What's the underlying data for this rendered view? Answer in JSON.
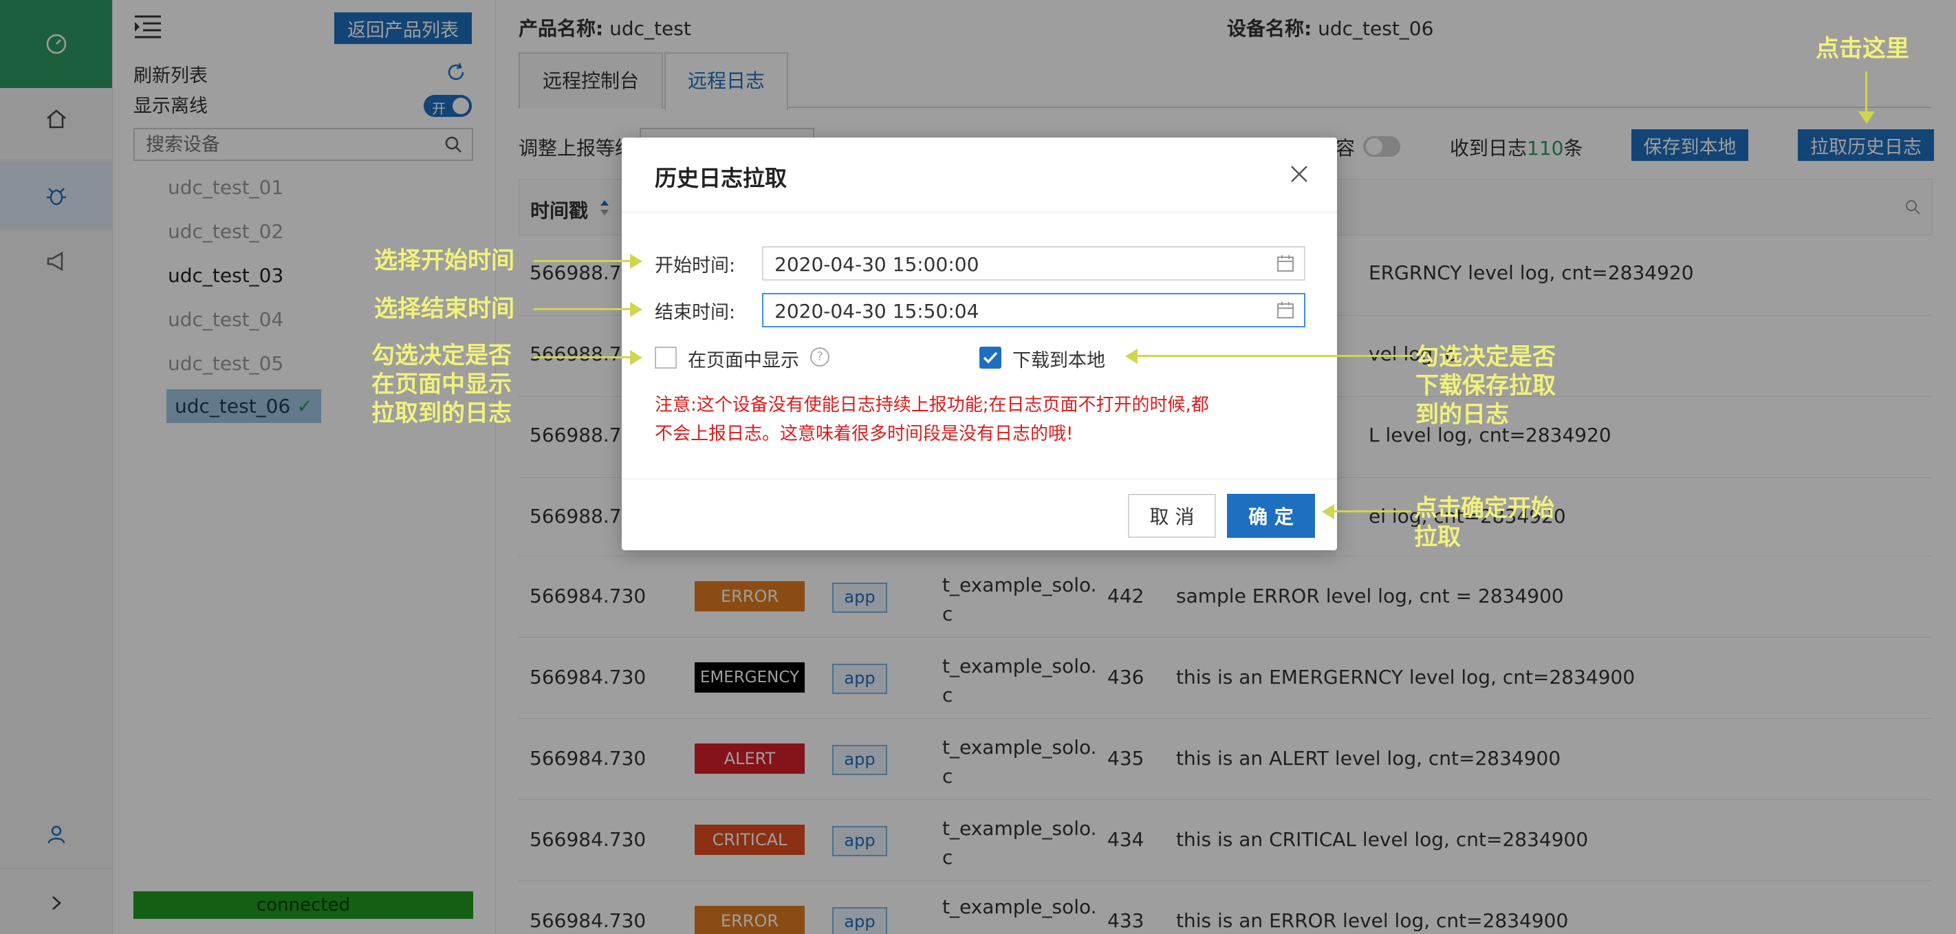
{
  "rail": {
    "icons": [
      "dashboard-icon",
      "home-icon",
      "bug-icon",
      "megaphone-icon",
      "user-icon",
      "chevron-right-icon"
    ]
  },
  "devpanel": {
    "back_button": "返回产品列表",
    "refresh_label": "刷新列表",
    "offline_label": "显示离线",
    "toggle_on": "开",
    "search_placeholder": "搜索设备",
    "devices": [
      {
        "name": "udc_test_01",
        "state": "offline"
      },
      {
        "name": "udc_test_02",
        "state": "offline"
      },
      {
        "name": "udc_test_03",
        "state": "online"
      },
      {
        "name": "udc_test_04",
        "state": "offline"
      },
      {
        "name": "udc_test_05",
        "state": "offline"
      },
      {
        "name": "udc_test_06",
        "state": "selected"
      }
    ],
    "status": "connected"
  },
  "header": {
    "product_label": "产品名称:",
    "product_value": "udc_test",
    "device_label": "设备名称:",
    "device_value": "udc_test_06"
  },
  "tabs": [
    {
      "label": "远程控制台",
      "active": false
    },
    {
      "label": "远程日志",
      "active": true
    }
  ],
  "toolbar": {
    "level_label": "调整上报等级",
    "compat_label": "容",
    "received_prefix": "收到日志",
    "received_count": "110",
    "received_suffix": "条",
    "save_button": "保存到本地",
    "pull_button": "拉取历史日志"
  },
  "table": {
    "header_timestamp": "时间戳",
    "rows": [
      {
        "ts": "566988.7",
        "level": "",
        "module": "",
        "file": "",
        "line": "",
        "msg": "ERGRNCY level log, cnt=2834920"
      },
      {
        "ts": "566988.7",
        "level": "",
        "module": "",
        "file": "",
        "line": "",
        "msg": "vel log, c"
      },
      {
        "ts": "566988.7",
        "level": "",
        "module": "",
        "file": "",
        "line": "",
        "msg": "L level log, cnt=2834920"
      },
      {
        "ts": "566988.7",
        "level": "",
        "module": "",
        "file": "",
        "line": "",
        "msg": "el log, cnt=2834920"
      },
      {
        "ts": "566984.730",
        "level": "ERROR",
        "module": "app",
        "file": "t_example_solo.\nc",
        "line": "442",
        "msg": "sample ERROR level log, cnt = 2834900"
      },
      {
        "ts": "566984.730",
        "level": "EMERGENCY",
        "module": "app",
        "file": "t_example_solo.\nc",
        "line": "436",
        "msg": "this is an EMERGERNCY level log, cnt=2834900"
      },
      {
        "ts": "566984.730",
        "level": "ALERT",
        "module": "app",
        "file": "t_example_solo.\nc",
        "line": "435",
        "msg": "this is an ALERT level log, cnt=2834900"
      },
      {
        "ts": "566984.730",
        "level": "CRITICAL",
        "module": "app",
        "file": "t_example_solo.\nc",
        "line": "434",
        "msg": "this is an CRITICAL level log, cnt=2834900"
      },
      {
        "ts": "566984.730",
        "level": "ERROR",
        "module": "app",
        "file": "t_example_solo.",
        "line": "433",
        "msg": "this is an ERROR level log, cnt=2834900"
      }
    ]
  },
  "colors": {
    "ERROR": "#e07b21",
    "EMERGENCY": "#000000",
    "ALERT": "#d81e2a",
    "CRITICAL": "#e24c1f",
    "accent": "#1e6fbf",
    "brand": "#2e9a62",
    "annotation": "#f1f27a"
  },
  "modal": {
    "title": "历史日志拉取",
    "start_label": "开始时间:",
    "start_value": "2020-04-30 15:00:00",
    "end_label": "结束时间:",
    "end_value": "2020-04-30 15:50:04",
    "show_on_page_label": "在页面中显示",
    "show_on_page_checked": false,
    "download_label": "下载到本地",
    "download_checked": true,
    "notice_line1": "注意:这个设备没有使能日志持续上报功能;在日志页面不打开的时候,都",
    "notice_line2": "不会上报日志。这意味着很多时间段是没有日志的哦!",
    "cancel_button": "取 消",
    "ok_button": "确 定"
  },
  "annotations": {
    "click_here": "点击这里",
    "choose_start": "选择开始时间",
    "choose_end": "选择结束时间",
    "show_decide": [
      "勾选决定是否",
      "在页面中显示",
      "拉取到的日志"
    ],
    "download_decide": [
      "勾选决定是否",
      "下载保存拉取",
      "到的日志"
    ],
    "ok_decide": [
      "点击确定开始",
      "拉取"
    ]
  }
}
